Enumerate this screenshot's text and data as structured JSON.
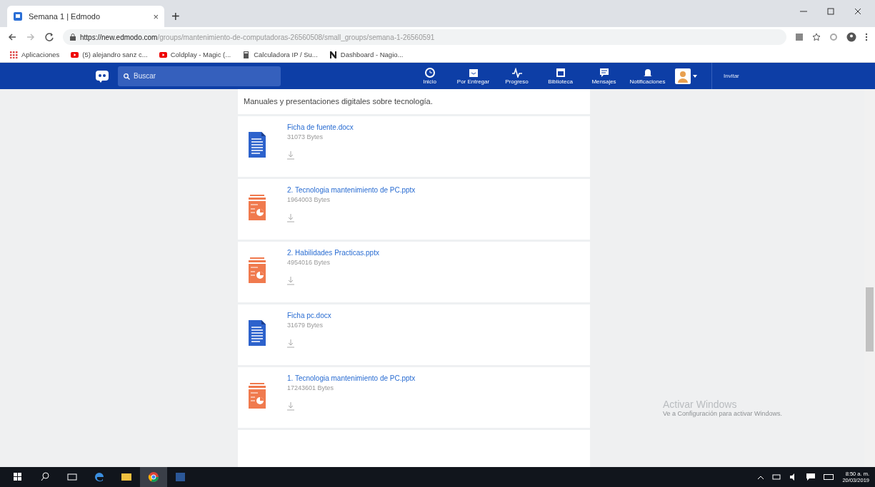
{
  "browser": {
    "tab": {
      "title": "Semana 1 | Edmodo",
      "close": "×",
      "new_tab": "+"
    },
    "url": {
      "host": "https://new.edmodo.com",
      "path": "/groups/mantenimiento-de-computadoras-26560508/small_groups/semana-1-26560591"
    },
    "bookmarks": [
      {
        "kind": "apps",
        "label": "Aplicaciones"
      },
      {
        "kind": "youtube",
        "label": "(5) alejandro sanz c..."
      },
      {
        "kind": "youtube",
        "label": "Coldplay - Magic (..."
      },
      {
        "kind": "calculator",
        "label": "Calculadora IP / Su..."
      },
      {
        "kind": "n",
        "label": "Dashboard - Nagio..."
      }
    ]
  },
  "app_bar": {
    "search": {
      "placeholder": "Buscar"
    },
    "nav": [
      {
        "kind": "home",
        "label": "Inicio"
      },
      {
        "kind": "due",
        "label": "Por Entregar"
      },
      {
        "kind": "progress",
        "label": "Progreso"
      },
      {
        "kind": "library",
        "label": "Biblioteca"
      },
      {
        "kind": "messages",
        "label": "Mensajes"
      },
      {
        "kind": "notifications",
        "label": "Notificaciones"
      }
    ],
    "invite": "Invitar"
  },
  "description": "Manuales y presentaciones digitales sobre tecnología.",
  "files": [
    {
      "kind": "docx",
      "name": "Ficha de fuente.docx",
      "size": "31073 Bytes"
    },
    {
      "kind": "pptx",
      "name": "2. Tecnologia mantenimiento de PC.pptx",
      "size": "1964003 Bytes"
    },
    {
      "kind": "pptx",
      "name": "2. Habilidades Practicas.pptx",
      "size": "4954016 Bytes"
    },
    {
      "kind": "docx",
      "name": "Ficha pc.docx",
      "size": "31679 Bytes"
    },
    {
      "kind": "pptx",
      "name": "1. Tecnologia mantenimiento de PC.pptx",
      "size": "17243601 Bytes"
    }
  ],
  "activation": {
    "title": "Activar Windows",
    "text": "Ve a Configuración para activar Windows."
  },
  "taskbar": {
    "time": "8:50 a. m.",
    "date": "20/03/2019"
  }
}
